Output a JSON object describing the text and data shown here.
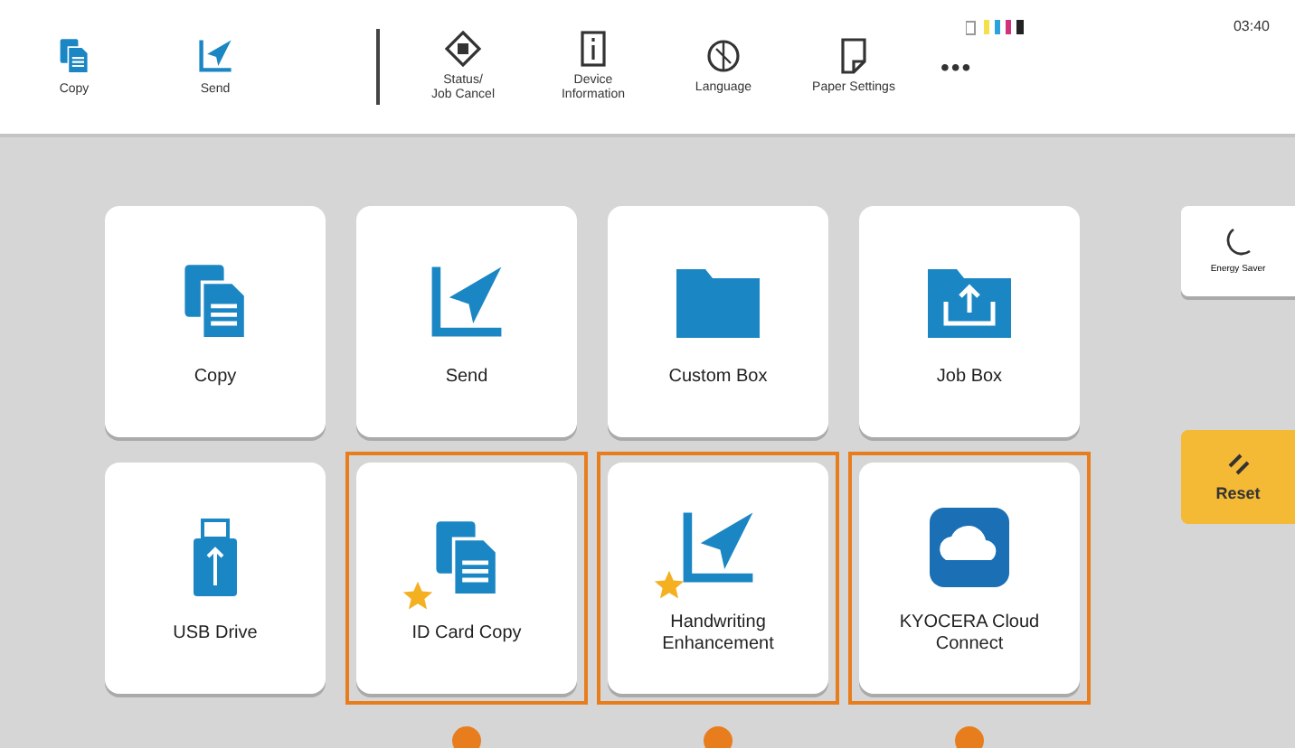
{
  "top_bar": {
    "shortcuts": [
      {
        "label": "Copy"
      },
      {
        "label": "Send"
      }
    ],
    "tools": [
      {
        "label": "Status/\nJob Cancel"
      },
      {
        "label": "Device\nInformation"
      },
      {
        "label": "Language"
      },
      {
        "label": "Paper Settings"
      }
    ],
    "more": "•••",
    "time": "03:40"
  },
  "tiles": [
    {
      "label": "Copy",
      "favorite": false,
      "highlighted": false
    },
    {
      "label": "Send",
      "favorite": false,
      "highlighted": false
    },
    {
      "label": "Custom Box",
      "favorite": false,
      "highlighted": false
    },
    {
      "label": "Job Box",
      "favorite": false,
      "highlighted": false
    },
    {
      "label": "USB Drive",
      "favorite": false,
      "highlighted": false
    },
    {
      "label": "ID Card Copy",
      "favorite": true,
      "highlighted": true
    },
    {
      "label": "Handwriting\nEnhancement",
      "favorite": true,
      "highlighted": true
    },
    {
      "label": "KYOCERA Cloud\nConnect",
      "favorite": false,
      "highlighted": true
    }
  ],
  "side": {
    "energy_saver": "Energy Saver",
    "reset": "Reset"
  }
}
